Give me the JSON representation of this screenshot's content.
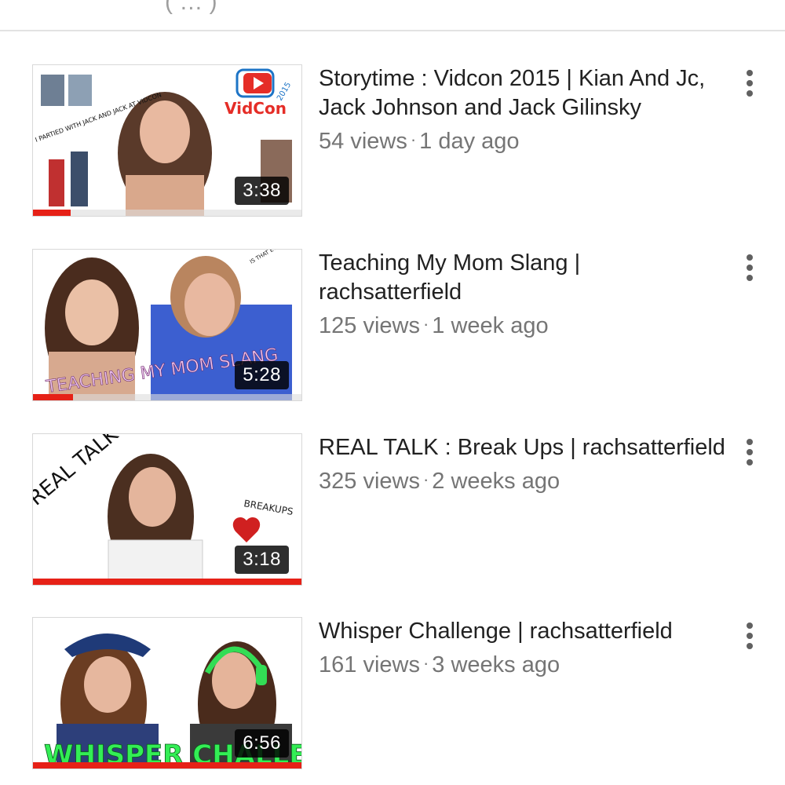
{
  "header": {
    "clipped_text": "( … )"
  },
  "videos": [
    {
      "title": "Storytime : Vidcon 2015 | Kian And Jc, Jack Johnson and Jack Gilinsky",
      "views": "54 views",
      "age": "1 day ago",
      "duration": "3:38",
      "watched_fraction": 0.14,
      "thumb_text": [
        "VidCon",
        "2015",
        "I PARTIED WITH JACK AND JACK AT VIDCON"
      ]
    },
    {
      "title": "Teaching My Mom Slang | rachsatterfield",
      "views": "125 views",
      "age": "1 week ago",
      "duration": "5:28",
      "watched_fraction": 0.15,
      "thumb_text": [
        "TEACHING MY MOM SLANG",
        "IS THAT EVEN A WORD?!"
      ]
    },
    {
      "title": "REAL TALK : Break Ups | rachsatterfield",
      "views": "325 views",
      "age": "2 weeks ago",
      "duration": "3:18",
      "watched_fraction": 1.0,
      "thumb_text": [
        "REAL TALK",
        "BREAKUPS"
      ]
    },
    {
      "title": "Whisper Challenge | rachsatterfield",
      "views": "161 views",
      "age": "3 weeks ago",
      "duration": "6:56",
      "watched_fraction": 1.0,
      "thumb_text": [
        "WHISPER CHALLENGE"
      ]
    }
  ],
  "colors": {
    "progress_red": "#e62117",
    "title": "#212121",
    "secondary": "#757575"
  },
  "icons": {
    "more": "more-vert-icon"
  }
}
